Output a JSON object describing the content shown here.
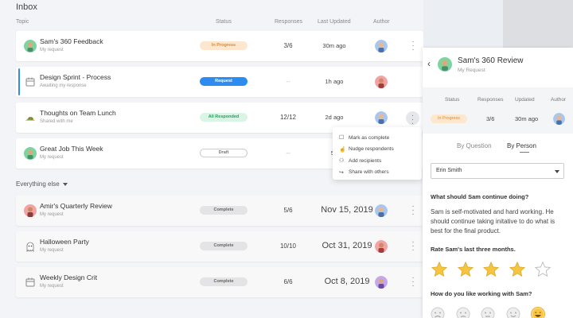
{
  "inbox": {
    "title": "Inbox",
    "columns": {
      "topic": "Topic",
      "status": "Status",
      "responses": "Responses",
      "updated": "Last Updated",
      "author": "Author"
    },
    "rows": [
      {
        "title": "Sam's 360 Feedback",
        "subtitle": "My request",
        "status": "In Progress",
        "responses": "3/6",
        "updated": "30m ago"
      },
      {
        "title": "Design Sprint - Process",
        "subtitle": "Awaiting my response",
        "status": "Request",
        "responses": "--",
        "updated": "1h ago"
      },
      {
        "title": "Thoughts on Team Lunch",
        "subtitle": "Shared with me",
        "status": "All Responded",
        "responses": "12/12",
        "updated": "2d ago"
      },
      {
        "title": "Great Job This Week",
        "subtitle": "My request",
        "status": "Draft",
        "responses": "--",
        "updated": "5d"
      }
    ]
  },
  "everything_else": {
    "label": "Everything else",
    "rows": [
      {
        "title": "Amir's Quarterly Review",
        "subtitle": "My request",
        "status": "Complete",
        "responses": "5/6",
        "updated": "Nov 15, 2019"
      },
      {
        "title": "Halloween Party",
        "subtitle": "My request",
        "status": "Complete",
        "responses": "10/10",
        "updated": "Oct 31, 2019"
      },
      {
        "title": "Weekly Design Crit",
        "subtitle": "My request",
        "status": "Complete",
        "responses": "6/6",
        "updated": "Oct 8, 2019"
      }
    ]
  },
  "context_menu": {
    "items": [
      {
        "label": "Mark as complete",
        "icon": "checkbox-icon"
      },
      {
        "label": "Nudge respondents",
        "icon": "nudge-icon"
      },
      {
        "label": "Add recipients",
        "icon": "add-user-icon"
      },
      {
        "label": "Share with others",
        "icon": "share-icon"
      }
    ]
  },
  "panel": {
    "title": "Sam's 360 Review",
    "subtitle": "My Request",
    "columns": {
      "status": "Status",
      "responses": "Responses",
      "updated": "Updated",
      "author": "Author"
    },
    "status": "In Progress",
    "responses": "3/6",
    "updated": "30m ago",
    "tabs": [
      "By Question",
      "By Person"
    ],
    "selected_person": "Erin Smith",
    "question1": "What should Sam continue doing?",
    "answer1": "Sam is self-motivated and hard working. He should continue taking initative to do what is best for the final product.",
    "question2": "Rate Sam's last three months.",
    "rating": 4,
    "rating_max": 5,
    "question3": "How do you like working with Sam?"
  },
  "colors": {
    "accent": "#2d8cf0",
    "star": "#f5c542",
    "in_progress": "#e08a2e",
    "all_responded": "#2a9d5c"
  }
}
